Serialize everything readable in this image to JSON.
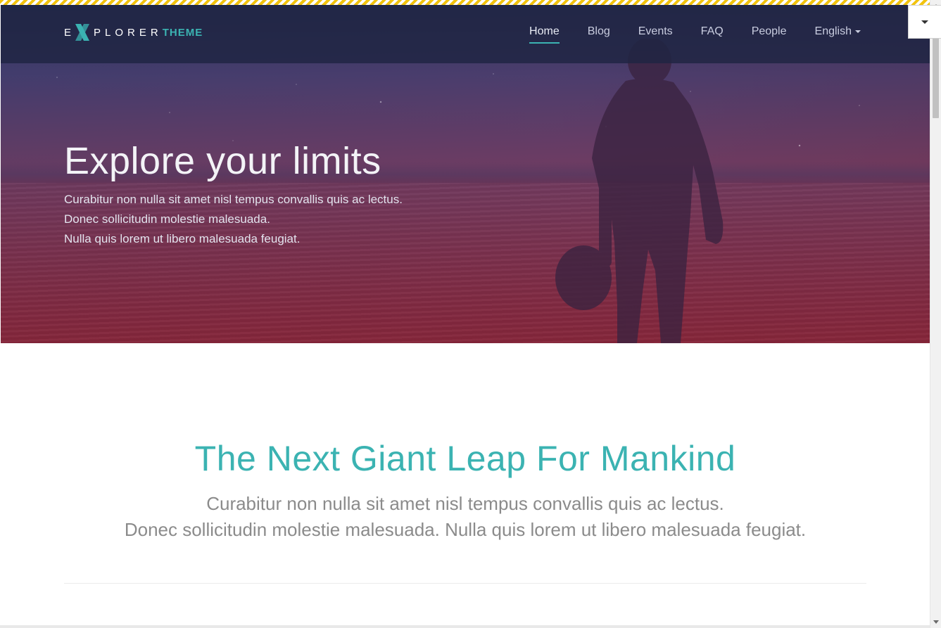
{
  "brand": {
    "logo_prefix": "E",
    "logo_mark": "x-logo-icon",
    "logo_rest": "PLORER",
    "logo_suffix": "THEME",
    "accent_color": "#3bb3b2"
  },
  "nav": {
    "items": [
      {
        "label": "Home",
        "active": true
      },
      {
        "label": "Blog",
        "active": false
      },
      {
        "label": "Events",
        "active": false
      },
      {
        "label": "FAQ",
        "active": false
      },
      {
        "label": "People",
        "active": false
      }
    ],
    "language": {
      "label": "English",
      "icon": "caret-down-icon"
    }
  },
  "corner_dropdown": {
    "icon": "chevron-down-icon"
  },
  "hero": {
    "title": "Explore your limits",
    "lines": [
      "Curabitur non nulla sit amet nisl tempus convallis quis ac lectus.",
      "Donec sollicitudin molestie malesuada.",
      "Nulla quis lorem ut libero malesuada feugiat."
    ]
  },
  "intro": {
    "title": "The Next Giant Leap For Mankind",
    "lines": [
      "Curabitur non nulla sit amet nisl tempus convallis quis ac lectus.",
      "Donec sollicitudin molestie malesuada. Nulla quis lorem ut libero malesuada feugiat."
    ]
  }
}
